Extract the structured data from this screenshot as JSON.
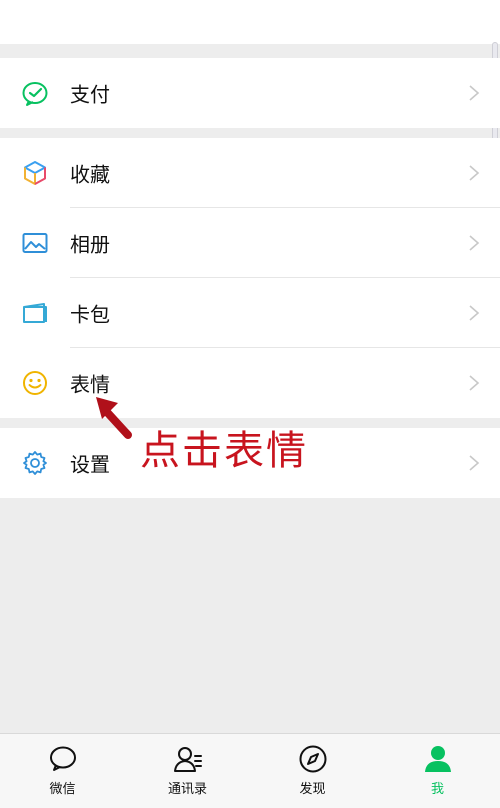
{
  "colors": {
    "background": "#ededed",
    "brand_green": "#07c160",
    "annotation_red": "#c8141e"
  },
  "menu": {
    "pay": {
      "label": "支付",
      "icon": "pay-icon"
    },
    "favorites": {
      "label": "收藏",
      "icon": "favorites-cube-icon"
    },
    "album": {
      "label": "相册",
      "icon": "album-icon"
    },
    "cards": {
      "label": "卡包",
      "icon": "cards-wallet-icon"
    },
    "stickers": {
      "label": "表情",
      "icon": "emoji-icon"
    },
    "settings": {
      "label": "设置",
      "icon": "gear-icon"
    }
  },
  "annotation": {
    "text": "点击表情"
  },
  "tabbar": {
    "tabs": [
      {
        "label": "微信",
        "icon": "chat-bubble-icon",
        "active": false
      },
      {
        "label": "通讯录",
        "icon": "contacts-icon",
        "active": false
      },
      {
        "label": "发现",
        "icon": "compass-icon",
        "active": false
      },
      {
        "label": "我",
        "icon": "person-icon",
        "active": true
      }
    ]
  }
}
